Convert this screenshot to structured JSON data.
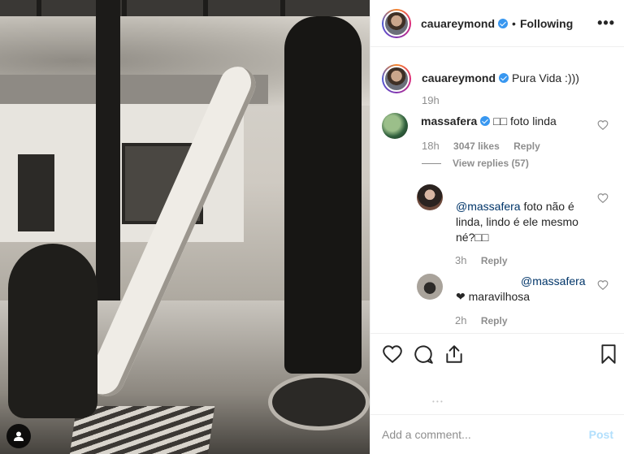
{
  "header": {
    "username": "cauareymond",
    "separator": "•",
    "follow_status": "Following",
    "more_label": "•••"
  },
  "caption": {
    "username": "cauareymond",
    "text": "Pura Vida :)))",
    "time": "19h"
  },
  "comments": [
    {
      "username": "massafera",
      "text": "□□ foto linda",
      "time": "18h",
      "likes": "3047 likes",
      "reply_label": "Reply",
      "view_replies": "View replies (57)"
    }
  ],
  "replies": [
    {
      "mention": "@massafera",
      "text": " foto não é linda, lindo é ele mesmo né?□□",
      "time": "3h",
      "reply_label": "Reply"
    },
    {
      "mention": "@massafera",
      "text": "❤ maravilhosa",
      "time": "2h",
      "reply_label": "Reply"
    }
  ],
  "composer": {
    "placeholder": "Add a comment...",
    "post_label": "Post"
  },
  "colors": {
    "verified": "#3897f0",
    "text": "#262626",
    "meta": "#8e8e8e",
    "post_disabled": "#b2dffc"
  }
}
